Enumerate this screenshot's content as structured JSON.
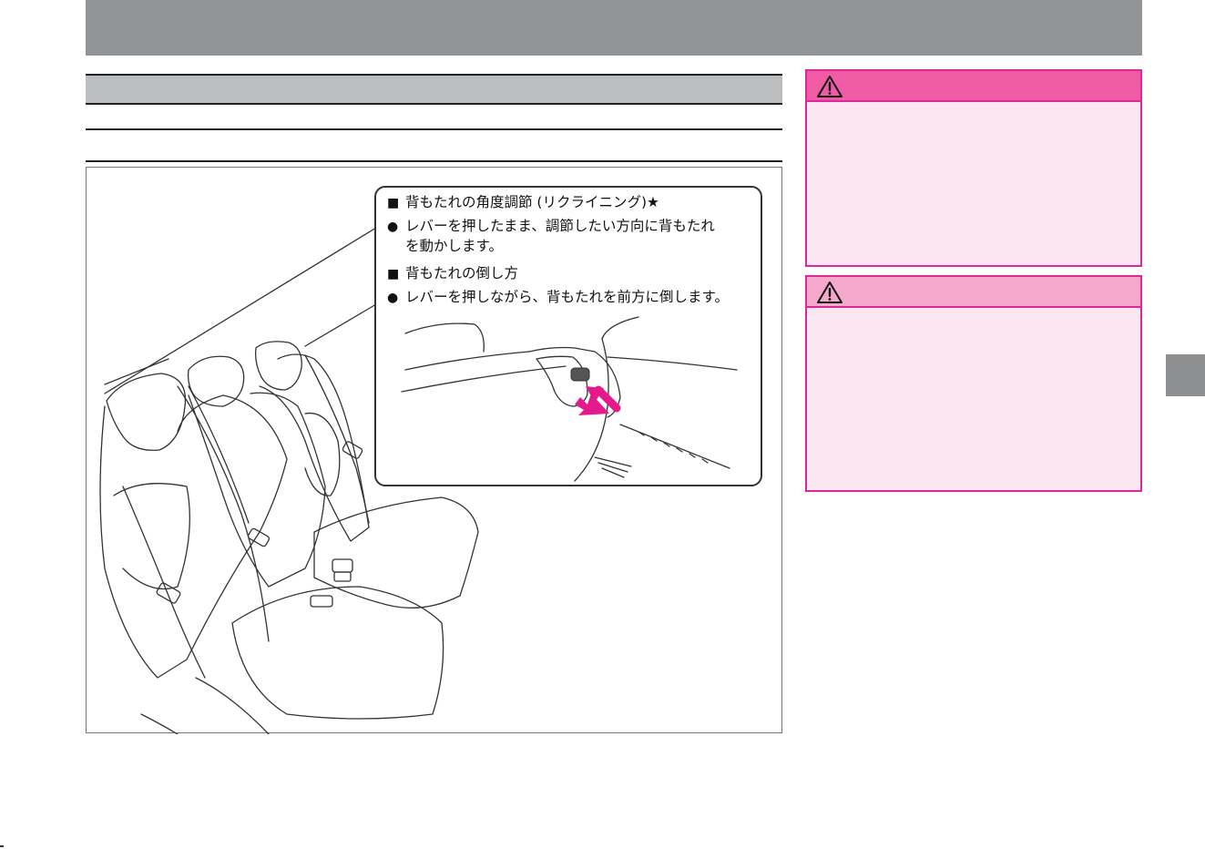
{
  "callout": {
    "heading_recline": "背もたれの角度調節 (リクライニング)★",
    "bullet_recline_1": "レバーを押したまま、調節したい方向に背もたれ",
    "bullet_recline_2": "を動かします。",
    "heading_fold": "背もたれの倒し方",
    "bullet_fold": "レバーを押しながら、背もたれを前方に倒します。",
    "square_mark": "■",
    "bullet_mark": "●"
  },
  "icons": {
    "warning": "warning-triangle-icon",
    "caution": "caution-triangle-icon"
  },
  "colors": {
    "header_gray": "#929395",
    "section_gray": "#bcbdbf",
    "warning_pink": "#ef5ca5",
    "caution_pink": "#f4a8cc",
    "box_border": "#e0279a",
    "box_fill": "#fbe7f1",
    "arrow_magenta": "#e6198c"
  }
}
